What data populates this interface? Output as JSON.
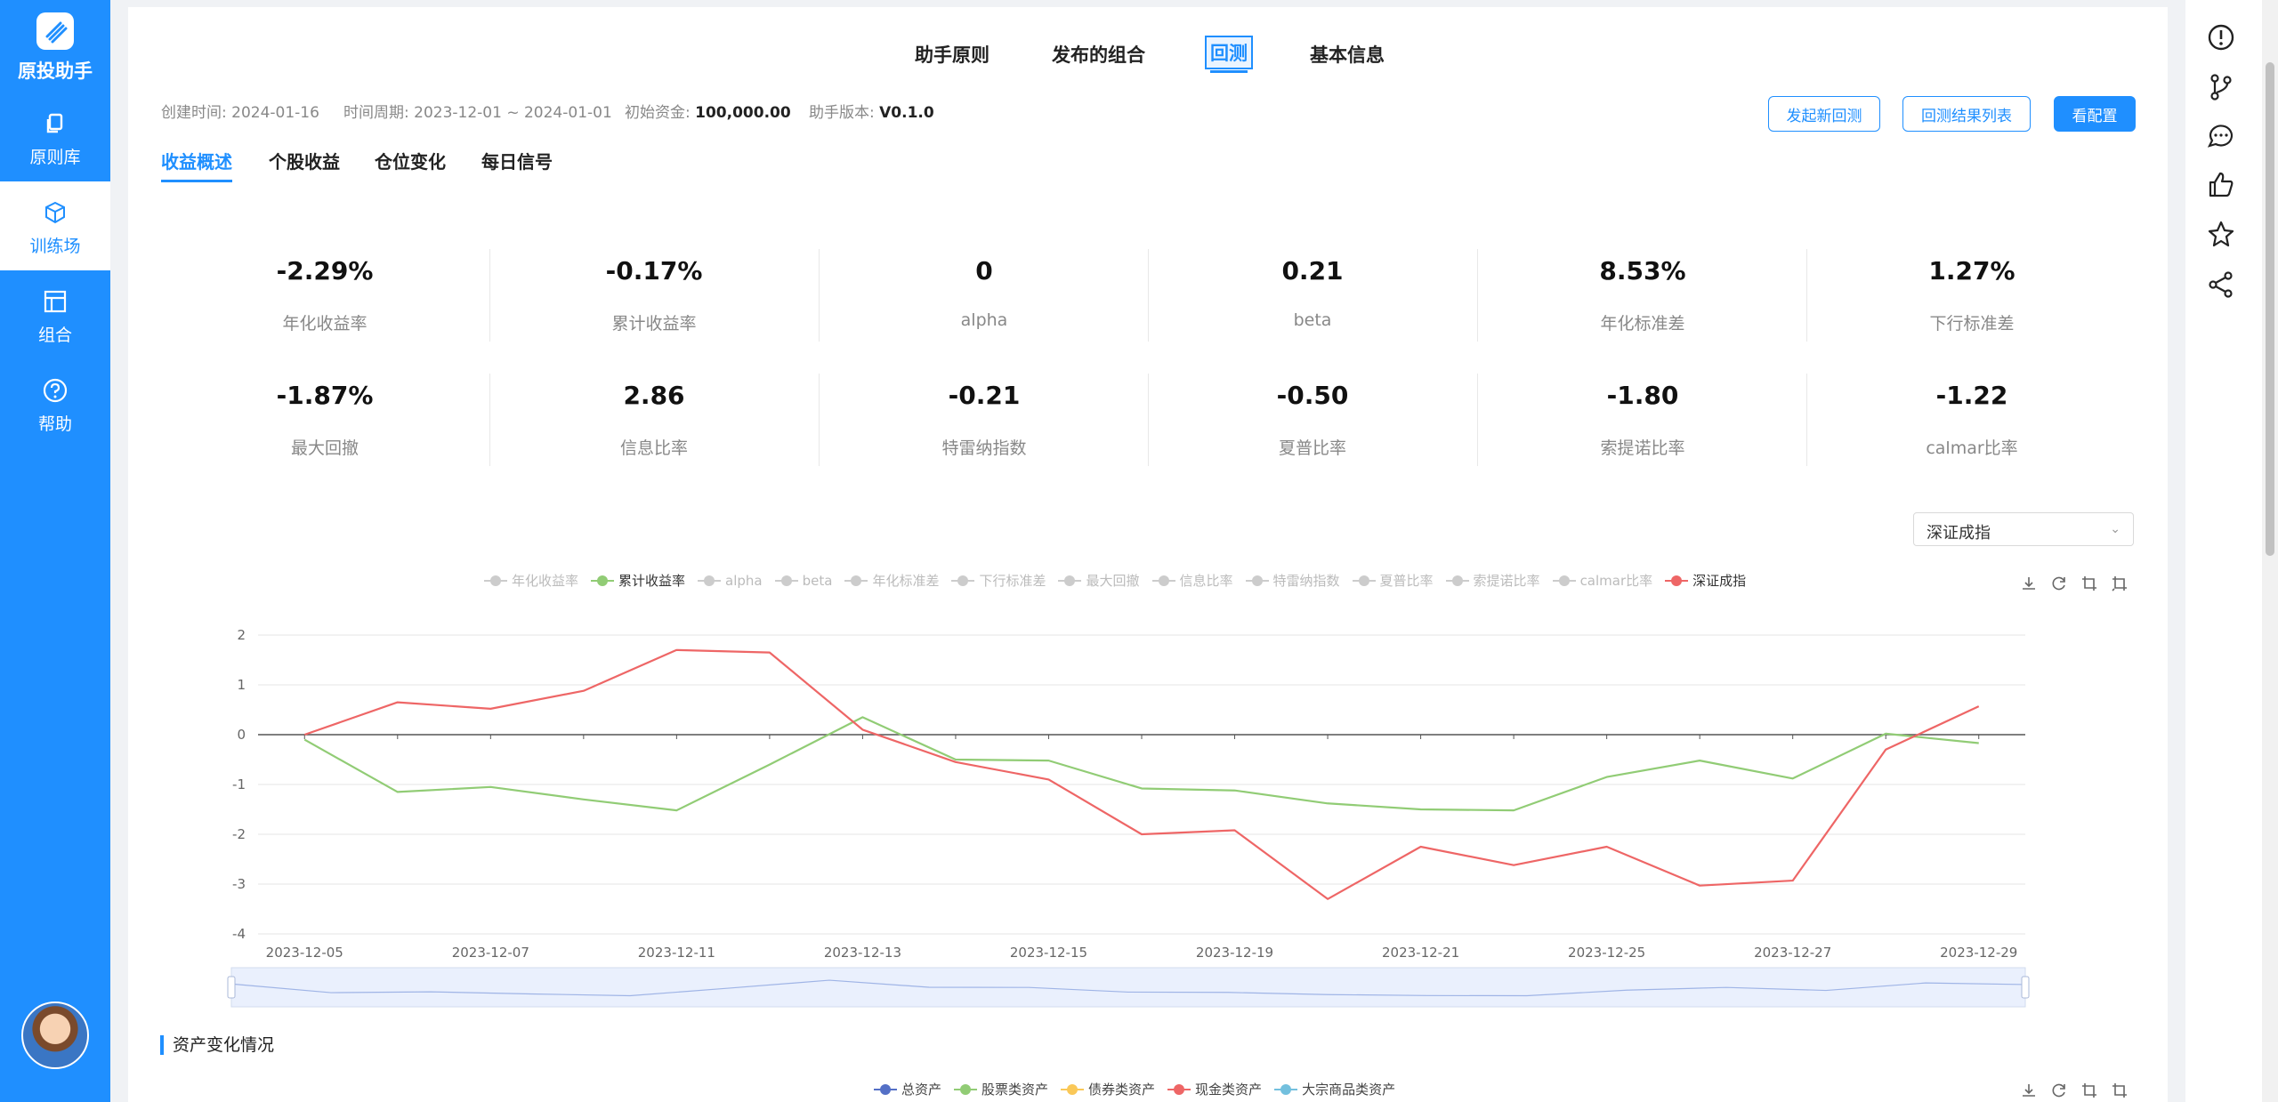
{
  "app": {
    "name": "原投助手"
  },
  "sidebar": {
    "items": [
      {
        "label": "原则库",
        "icon": "copy-icon"
      },
      {
        "label": "训练场",
        "icon": "cube-icon",
        "active": true
      },
      {
        "label": "组合",
        "icon": "layout-icon"
      },
      {
        "label": "帮助",
        "icon": "question-icon"
      }
    ]
  },
  "top_tabs": [
    {
      "label": "助手原则"
    },
    {
      "label": "发布的组合"
    },
    {
      "label": "回测",
      "active": true
    },
    {
      "label": "基本信息"
    }
  ],
  "meta": {
    "created_label": "创建时间:",
    "created_value": "2024-01-16",
    "period_label": "时间周期:",
    "period_value": "2023-12-01 ~ 2024-01-01",
    "capital_label": "初始资金:",
    "capital_value": "100,000.00",
    "version_label": "助手版本:",
    "version_value": "V0.1.0"
  },
  "actions": {
    "new_backtest": "发起新回测",
    "result_list": "回测结果列表",
    "view_config": "看配置"
  },
  "sub_tabs": [
    {
      "label": "收益概述",
      "active": true
    },
    {
      "label": "个股收益"
    },
    {
      "label": "仓位变化"
    },
    {
      "label": "每日信号"
    }
  ],
  "metrics": [
    {
      "value": "-2.29%",
      "label": "年化收益率"
    },
    {
      "value": "-0.17%",
      "label": "累计收益率"
    },
    {
      "value": "0",
      "label": "alpha"
    },
    {
      "value": "0.21",
      "label": "beta"
    },
    {
      "value": "8.53%",
      "label": "年化标准差"
    },
    {
      "value": "1.27%",
      "label": "下行标准差"
    },
    {
      "value": "-1.87%",
      "label": "最大回撤"
    },
    {
      "value": "2.86",
      "label": "信息比率"
    },
    {
      "value": "-0.21",
      "label": "特雷纳指数"
    },
    {
      "value": "-0.50",
      "label": "夏普比率"
    },
    {
      "value": "-1.80",
      "label": "索提诺比率"
    },
    {
      "value": "-1.22",
      "label": "calmar比率"
    }
  ],
  "benchmark_select": {
    "value": "深证成指"
  },
  "chart_legend": [
    {
      "name": "年化收益率",
      "active": false
    },
    {
      "name": "累计收益率",
      "active": true,
      "color": "#91cc75"
    },
    {
      "name": "alpha",
      "active": false
    },
    {
      "name": "beta",
      "active": false
    },
    {
      "name": "年化标准差",
      "active": false
    },
    {
      "name": "下行标准差",
      "active": false
    },
    {
      "name": "最大回撤",
      "active": false
    },
    {
      "name": "信息比率",
      "active": false
    },
    {
      "name": "特雷纳指数",
      "active": false
    },
    {
      "name": "夏普比率",
      "active": false
    },
    {
      "name": "索提诺比率",
      "active": false
    },
    {
      "name": "calmar比率",
      "active": false
    },
    {
      "name": "深证成指",
      "active": true,
      "color": "#ee6666"
    }
  ],
  "chart_data": {
    "type": "line",
    "x": [
      "2023-12-05",
      "2023-12-06",
      "2023-12-07",
      "2023-12-08",
      "2023-12-11",
      "2023-12-12",
      "2023-12-13",
      "2023-12-14",
      "2023-12-15",
      "2023-12-18",
      "2023-12-19",
      "2023-12-20",
      "2023-12-21",
      "2023-12-22",
      "2023-12-25",
      "2023-12-26",
      "2023-12-27",
      "2023-12-28",
      "2023-12-29"
    ],
    "x_tick_labels": [
      "2023-12-05",
      "2023-12-07",
      "2023-12-11",
      "2023-12-13",
      "2023-12-15",
      "2023-12-19",
      "2023-12-21",
      "2023-12-25",
      "2023-12-27",
      "2023-12-29"
    ],
    "ylim": [
      -4,
      2
    ],
    "yticks": [
      2,
      1,
      0,
      -1,
      -2,
      -3,
      -4
    ],
    "series": [
      {
        "name": "累计收益率",
        "color": "#91cc75",
        "values": [
          -0.1,
          -1.15,
          -1.05,
          -1.3,
          -1.52,
          -0.6,
          0.35,
          -0.5,
          -0.52,
          -1.08,
          -1.12,
          -1.38,
          -1.5,
          -1.52,
          -0.85,
          -0.52,
          -0.88,
          0.02,
          -0.17
        ]
      },
      {
        "name": "深证成指",
        "color": "#ee6666",
        "values": [
          0.0,
          0.65,
          0.52,
          0.88,
          1.7,
          1.65,
          0.1,
          -0.55,
          -0.9,
          -2.0,
          -1.92,
          -3.3,
          -2.25,
          -2.62,
          -2.25,
          -3.03,
          -2.93,
          -0.3,
          0.57
        ]
      }
    ],
    "grid": true,
    "legend_position": "top"
  },
  "section2": {
    "title": "资产变化情况",
    "legend": [
      {
        "name": "总资产",
        "color": "#5470c6"
      },
      {
        "name": "股票类资产",
        "color": "#91cc75"
      },
      {
        "name": "债券类资产",
        "color": "#fac858"
      },
      {
        "name": "现金类资产",
        "color": "#ee6666"
      },
      {
        "name": "大宗商品类资产",
        "color": "#73c0de"
      }
    ]
  }
}
